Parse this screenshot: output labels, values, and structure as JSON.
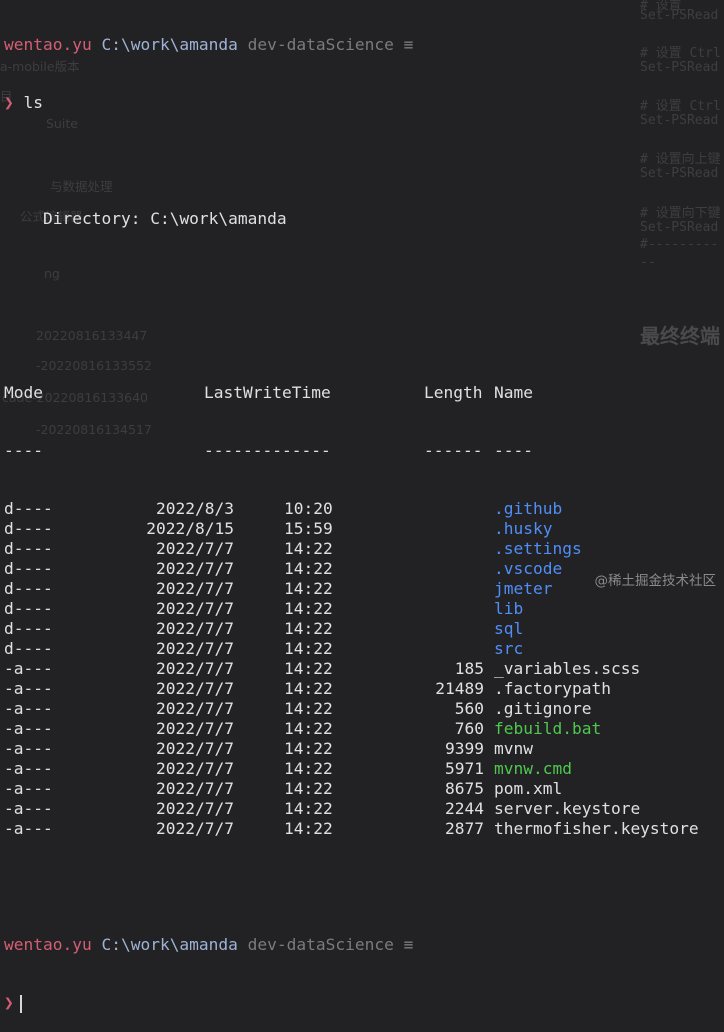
{
  "background_ghost": {
    "left_fragments": [
      "a-mobile版本",
      "目",
      "Suite",
      "与数据处理",
      "公式编辑器",
      "ng",
      "20220816133447",
      "-20220816133552",
      "cade-20220816133640",
      "-20220816134517"
    ],
    "right_lines": [
      "# 设置",
      "Set-PSRead",
      "# 设置 Ctrl",
      "Set-PSRead",
      "# 设置 Ctrl",
      "Set-PSRead",
      "# 设置向上键",
      "Set-PSRead",
      "# 设置向下键",
      "Set-PSRead",
      "#---------",
      "--"
    ],
    "right_heading": "最终终端"
  },
  "prompt": {
    "user": "wentao.yu",
    "path": "C:\\work\\amanda",
    "branch": "dev-dataScience",
    "status_glyph": "≡",
    "caret": "❯",
    "command": "ls"
  },
  "listing": {
    "directory_label": "Directory:",
    "directory_path": "C:\\work\\amanda",
    "headers": {
      "mode": "Mode",
      "lastwrite": "LastWriteTime",
      "length": "Length",
      "name": "Name"
    },
    "underlines": {
      "mode": "----",
      "lastwrite": "-------------",
      "length": "------",
      "name": "----"
    },
    "rows": [
      {
        "mode": "d----",
        "date": "2022/8/3",
        "time": "10:20",
        "length": "",
        "name": ".github",
        "kind": "dir"
      },
      {
        "mode": "d----",
        "date": "2022/8/15",
        "time": "15:59",
        "length": "",
        "name": ".husky",
        "kind": "dir"
      },
      {
        "mode": "d----",
        "date": "2022/7/7",
        "time": "14:22",
        "length": "",
        "name": ".settings",
        "kind": "dir"
      },
      {
        "mode": "d----",
        "date": "2022/7/7",
        "time": "14:22",
        "length": "",
        "name": ".vscode",
        "kind": "dir"
      },
      {
        "mode": "d----",
        "date": "2022/7/7",
        "time": "14:22",
        "length": "",
        "name": "jmeter",
        "kind": "dir"
      },
      {
        "mode": "d----",
        "date": "2022/7/7",
        "time": "14:22",
        "length": "",
        "name": "lib",
        "kind": "dir"
      },
      {
        "mode": "d----",
        "date": "2022/7/7",
        "time": "14:22",
        "length": "",
        "name": "sql",
        "kind": "dir"
      },
      {
        "mode": "d----",
        "date": "2022/7/7",
        "time": "14:22",
        "length": "",
        "name": "src",
        "kind": "dir"
      },
      {
        "mode": "-a---",
        "date": "2022/7/7",
        "time": "14:22",
        "length": "185",
        "name": "_variables.scss",
        "kind": "file"
      },
      {
        "mode": "-a---",
        "date": "2022/7/7",
        "time": "14:22",
        "length": "21489",
        "name": ".factorypath",
        "kind": "file"
      },
      {
        "mode": "-a---",
        "date": "2022/7/7",
        "time": "14:22",
        "length": "560",
        "name": ".gitignore",
        "kind": "file"
      },
      {
        "mode": "-a---",
        "date": "2022/7/7",
        "time": "14:22",
        "length": "760",
        "name": "febuild.bat",
        "kind": "exe"
      },
      {
        "mode": "-a---",
        "date": "2022/7/7",
        "time": "14:22",
        "length": "9399",
        "name": "mvnw",
        "kind": "file"
      },
      {
        "mode": "-a---",
        "date": "2022/7/7",
        "time": "14:22",
        "length": "5971",
        "name": "mvnw.cmd",
        "kind": "exe"
      },
      {
        "mode": "-a---",
        "date": "2022/7/7",
        "time": "14:22",
        "length": "8675",
        "name": "pom.xml",
        "kind": "file"
      },
      {
        "mode": "-a---",
        "date": "2022/7/7",
        "time": "14:22",
        "length": "2244",
        "name": "server.keystore",
        "kind": "file"
      },
      {
        "mode": "-a---",
        "date": "2022/7/7",
        "time": "14:22",
        "length": "2877",
        "name": "thermofisher.keystore",
        "kind": "file"
      }
    ]
  },
  "watermark": "@稀土掘金技术社区",
  "colors": {
    "background": "#222224",
    "user": "#d45f74",
    "path": "#9fb3d6",
    "directory": "#4f8ef7",
    "executable": "#4ec94e",
    "text": "#e0e0e0"
  }
}
